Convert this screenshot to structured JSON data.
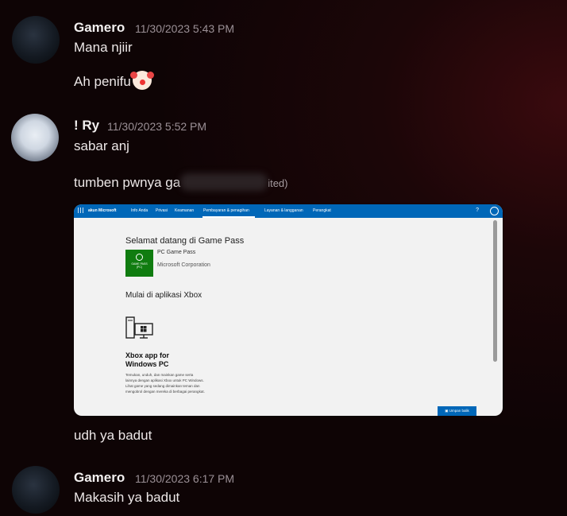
{
  "messages": [
    {
      "avatar": "avatar-dark-hooded",
      "username": "Gamero",
      "timestamp": "11/30/2023 5:43 PM",
      "lines": [
        "Mana njiir",
        "Ah penifu"
      ]
    },
    {
      "avatar": "avatar-anime-white-hood",
      "username": "! Ry",
      "timestamp": "11/30/2023 5:52 PM",
      "lines": [
        "sabar anj",
        "tumben pwnya ga",
        "ited)",
        "udh ya badut"
      ]
    },
    {
      "avatar": "avatar-dark-hooded",
      "username": "Gamero",
      "timestamp": "11/30/2023 6:17 PM",
      "lines": [
        "Makasih ya badut"
      ]
    }
  ],
  "attachment": {
    "nav": {
      "brand": "akun Microsoft",
      "items": [
        "Info Anda",
        "Privasi",
        "Keamanan",
        "Pembayaran & penagihan",
        "Layanan & langganan",
        "Perangkat"
      ],
      "help": "?"
    },
    "welcome_title": "Selamat datang di Game Pass",
    "tile_text": "GAME PASS",
    "tile_sub": "(PC)",
    "product_name": "PC Game Pass",
    "publisher": "Microsoft Corporation",
    "start_title": "Mulai di aplikasi Xbox",
    "app_title": "Xbox app for Windows PC",
    "app_desc": "Temukan, unduh, dan mainkan game serta lainnya dengan aplikasi Xbox untuk PC Windows. Lihat game yang sedang dimainkan teman dan mengobrol dengan mereka di berbagai perangkat.",
    "feedback_button": "Umpan balik"
  },
  "colors": {
    "ms_blue": "#0067b8",
    "xbox_green": "#107c10",
    "background": "#1c0608"
  }
}
